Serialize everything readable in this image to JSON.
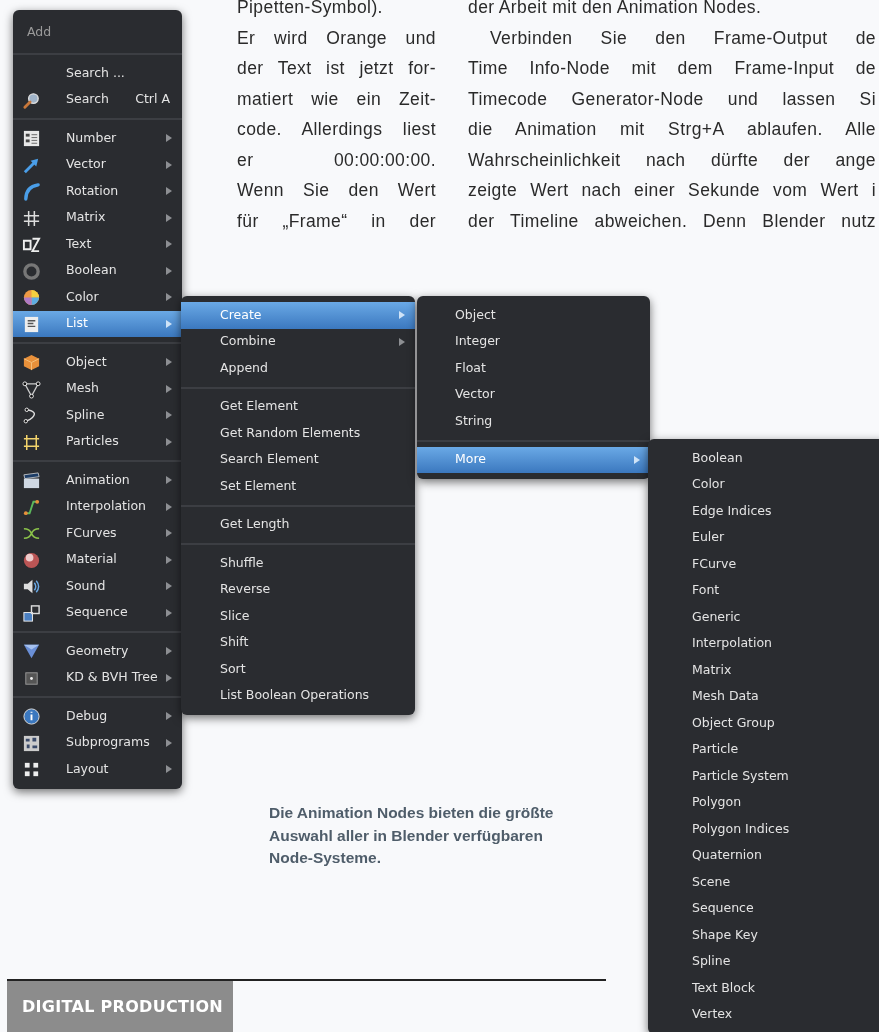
{
  "article": {
    "column_1": [
      {
        "lines": [
          "Pipetten-Symbol).",
          "Er wird Orange und",
          "der Text ist jetzt for-",
          "matiert wie ein Zeit-",
          "code. Allerdings liest",
          "er 00:00:00:00.",
          "Wenn Sie den Wert",
          "für „Frame“ in der"
        ],
        "complete": false,
        "indent": false
      }
    ],
    "column_2": [
      {
        "lines": [
          "der Arbeit mit den Animation Nodes."
        ],
        "complete": true,
        "indent": false
      },
      {
        "lines": [
          "Verbinden Sie den Frame-Output de",
          "Time Info-Node mit dem Frame-Input de",
          "Timecode Generator-Node und lassen Si",
          "die Animation mit Strg+A ablaufen. Alle",
          "Wahrscheinlichkeit nach dürfte der ange",
          "zeigte Wert nach einer Sekunde vom Wert i",
          "der Timeline abweichen. Denn Blender nutz"
        ],
        "complete": false,
        "indent": true
      }
    ]
  },
  "menus": [
    {
      "title": "Add",
      "sections": [
        {
          "items": [
            {
              "label": "Search ...",
              "submenu": false,
              "selected": false
            },
            {
              "label": "Search",
              "shortcut": "Ctrl A",
              "submenu": false,
              "selected": false
            }
          ]
        },
        {
          "items": [
            {
              "label": "Number",
              "submenu": true,
              "selected": false
            },
            {
              "label": "Vector",
              "submenu": true,
              "selected": false
            },
            {
              "label": "Rotation",
              "submenu": true,
              "selected": false
            },
            {
              "label": "Matrix",
              "submenu": true,
              "selected": false
            },
            {
              "label": "Text",
              "submenu": true,
              "selected": false
            },
            {
              "label": "Boolean",
              "submenu": true,
              "selected": false
            },
            {
              "label": "Color",
              "submenu": true,
              "selected": false
            },
            {
              "label": "List",
              "submenu": true,
              "selected": true
            }
          ]
        },
        {
          "items": [
            {
              "label": "Object",
              "submenu": true,
              "selected": false
            },
            {
              "label": "Mesh",
              "submenu": true,
              "selected": false
            },
            {
              "label": "Spline",
              "submenu": true,
              "selected": false
            },
            {
              "label": "Particles",
              "submenu": true,
              "selected": false
            }
          ]
        },
        {
          "items": [
            {
              "label": "Animation",
              "submenu": true,
              "selected": false
            },
            {
              "label": "Interpolation",
              "submenu": true,
              "selected": false
            },
            {
              "label": "FCurves",
              "submenu": true,
              "selected": false
            },
            {
              "label": "Material",
              "submenu": true,
              "selected": false
            },
            {
              "label": "Sound",
              "submenu": true,
              "selected": false
            },
            {
              "label": "Sequence",
              "submenu": true,
              "selected": false
            }
          ]
        },
        {
          "items": [
            {
              "label": "Geometry",
              "submenu": true,
              "selected": false
            },
            {
              "label": "KD & BVH Tree",
              "submenu": true,
              "selected": false
            }
          ]
        },
        {
          "items": [
            {
              "label": "Debug",
              "submenu": true,
              "selected": false
            },
            {
              "label": "Subprograms",
              "submenu": true,
              "selected": false
            },
            {
              "label": "Layout",
              "submenu": true,
              "selected": false
            }
          ]
        }
      ]
    },
    {
      "sections": [
        {
          "items": [
            {
              "label": "Create",
              "submenu": true,
              "selected": true
            },
            {
              "label": "Combine",
              "submenu": true,
              "selected": false
            },
            {
              "label": "Append",
              "submenu": false,
              "selected": false
            }
          ]
        },
        {
          "items": [
            {
              "label": "Get Element",
              "submenu": false,
              "selected": false
            },
            {
              "label": "Get Random Elements",
              "submenu": false,
              "selected": false
            },
            {
              "label": "Search Element",
              "submenu": false,
              "selected": false
            },
            {
              "label": "Set Element",
              "submenu": false,
              "selected": false
            }
          ]
        },
        {
          "items": [
            {
              "label": "Get Length",
              "submenu": false,
              "selected": false
            }
          ]
        },
        {
          "items": [
            {
              "label": "Shuffle",
              "submenu": false,
              "selected": false
            },
            {
              "label": "Reverse",
              "submenu": false,
              "selected": false
            },
            {
              "label": "Slice",
              "submenu": false,
              "selected": false
            },
            {
              "label": "Shift",
              "submenu": false,
              "selected": false
            },
            {
              "label": "Sort",
              "submenu": false,
              "selected": false
            },
            {
              "label": "List Boolean Operations",
              "submenu": false,
              "selected": false
            }
          ]
        }
      ]
    },
    {
      "sections": [
        {
          "items": [
            {
              "label": "Object",
              "submenu": false,
              "selected": false
            },
            {
              "label": "Integer",
              "submenu": false,
              "selected": false
            },
            {
              "label": "Float",
              "submenu": false,
              "selected": false
            },
            {
              "label": "Vector",
              "submenu": false,
              "selected": false
            },
            {
              "label": "String",
              "submenu": false,
              "selected": false
            }
          ]
        },
        {
          "items": [
            {
              "label": "More",
              "submenu": true,
              "selected": true
            }
          ]
        }
      ]
    },
    {
      "sections": [
        {
          "items": [
            {
              "label": "Boolean",
              "submenu": false,
              "selected": false
            },
            {
              "label": "Color",
              "submenu": false,
              "selected": false
            },
            {
              "label": "Edge Indices",
              "submenu": false,
              "selected": false
            },
            {
              "label": "Euler",
              "submenu": false,
              "selected": false
            },
            {
              "label": "FCurve",
              "submenu": false,
              "selected": false
            },
            {
              "label": "Font",
              "submenu": false,
              "selected": false
            },
            {
              "label": "Generic",
              "submenu": false,
              "selected": false
            },
            {
              "label": "Interpolation",
              "submenu": false,
              "selected": false
            },
            {
              "label": "Matrix",
              "submenu": false,
              "selected": false
            },
            {
              "label": "Mesh Data",
              "submenu": false,
              "selected": false
            },
            {
              "label": "Object Group",
              "submenu": false,
              "selected": false
            },
            {
              "label": "Particle",
              "submenu": false,
              "selected": false
            },
            {
              "label": "Particle System",
              "submenu": false,
              "selected": false
            },
            {
              "label": "Polygon",
              "submenu": false,
              "selected": false
            },
            {
              "label": "Polygon Indices",
              "submenu": false,
              "selected": false
            },
            {
              "label": "Quaternion",
              "submenu": false,
              "selected": false
            },
            {
              "label": "Scene",
              "submenu": false,
              "selected": false
            },
            {
              "label": "Sequence",
              "submenu": false,
              "selected": false
            },
            {
              "label": "Shape Key",
              "submenu": false,
              "selected": false
            },
            {
              "label": "Spline",
              "submenu": false,
              "selected": false
            },
            {
              "label": "Text Block",
              "submenu": false,
              "selected": false
            },
            {
              "label": "Vertex",
              "submenu": false,
              "selected": false
            }
          ]
        }
      ]
    }
  ],
  "caption": "Die Animation Nodes bieten die größte Auswahl aller in Blender verfügbaren Node-Systeme.",
  "footer": {
    "brand": "DIGITAL PRODUCTION"
  }
}
